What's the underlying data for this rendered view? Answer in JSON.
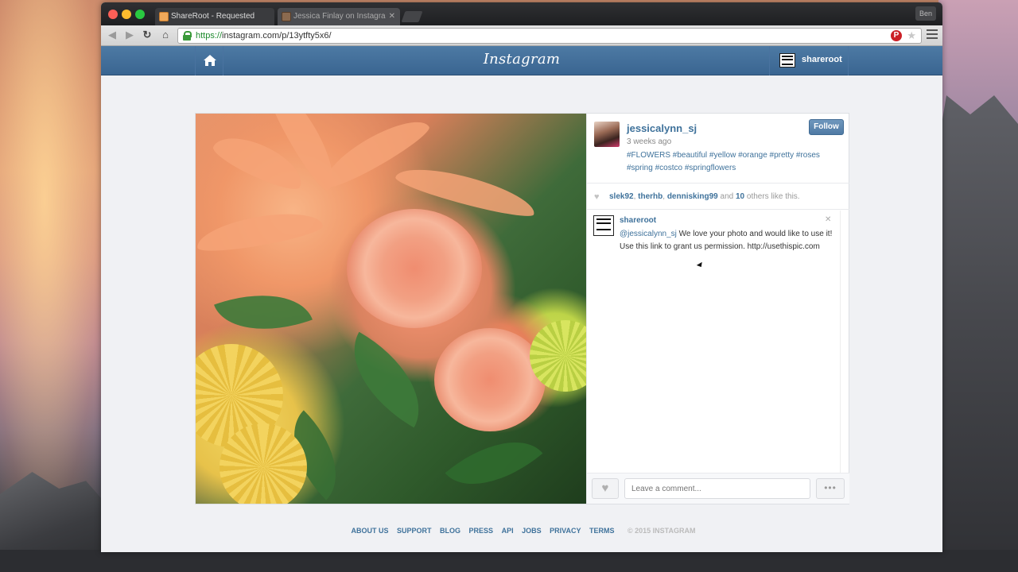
{
  "browser": {
    "tabs": [
      {
        "title": "ShareRoot - Requested",
        "active": false
      },
      {
        "title": "Jessica Finlay on Instagra",
        "active": true
      }
    ],
    "profile": "Ben",
    "url_scheme": "https://",
    "url_rest": "instagram.com/p/13ytfty5x6/"
  },
  "header": {
    "logo": "Instagram",
    "username": "shareroot"
  },
  "post": {
    "owner": "jessicalynn_sj",
    "follow_label": "Follow",
    "time_ago": "3 weeks ago",
    "tags": "#FLOWERS #beautiful #yellow #orange #pretty #roses #spring #costco #springflowers",
    "likes": {
      "users": [
        "slek92",
        "therhb",
        "dennisking99"
      ],
      "and_text": "and",
      "count": "10",
      "suffix": "others like this."
    },
    "comment": {
      "author": "shareroot",
      "mention": "@jessicalynn_sj",
      "text": " We love your photo and would like to use it! Use this link to grant us permission. http://usethispic.com"
    },
    "comment_placeholder": "Leave a comment...",
    "more_label": "•••"
  },
  "footer": {
    "links": [
      "ABOUT US",
      "SUPPORT",
      "BLOG",
      "PRESS",
      "API",
      "JOBS",
      "PRIVACY",
      "TERMS"
    ],
    "copyright": "© 2015 INSTAGRAM"
  }
}
